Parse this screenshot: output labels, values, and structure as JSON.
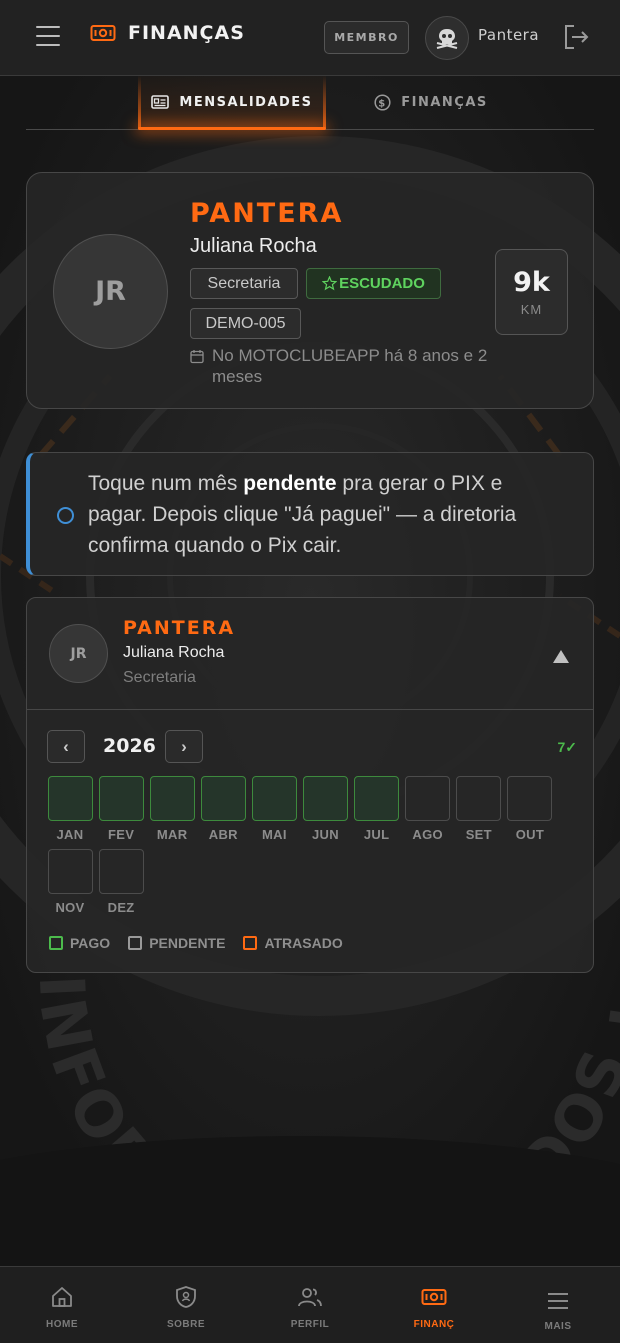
{
  "header": {
    "title": "FINANÇAS",
    "member_badge": "MEMBRO",
    "user_name": "Pantera"
  },
  "tabs": [
    {
      "label": "MENSALIDADES",
      "active": true
    },
    {
      "label": "FINANÇAS",
      "active": false
    }
  ],
  "profile": {
    "initials": "JR",
    "nickname": "PANTERA",
    "name": "Juliana Rocha",
    "role": "Secretaria",
    "status": "ESCUDADO",
    "code": "DEMO-005",
    "since": "No MOTOCLUBEAPP há 8 anos e 2 meses",
    "km_value": "9k",
    "km_label": "KM"
  },
  "info": {
    "text_before": "Toque num mês ",
    "text_bold": "pendente",
    "text_after": " pra gerar o PIX e pagar. Depois clique \"Já paguei\" — a diretoria confirma quando o Pix cair."
  },
  "member_card": {
    "initials": "JR",
    "nickname": "PANTERA",
    "name": "Juliana Rocha",
    "role": "Secretaria",
    "year": "2026",
    "prev_label": "‹",
    "next_label": "›",
    "paid_count": "7✓",
    "months": [
      {
        "label": "JAN",
        "status": "pago"
      },
      {
        "label": "FEV",
        "status": "pago"
      },
      {
        "label": "MAR",
        "status": "pago"
      },
      {
        "label": "ABR",
        "status": "pago"
      },
      {
        "label": "MAI",
        "status": "pago"
      },
      {
        "label": "JUN",
        "status": "pago"
      },
      {
        "label": "JUL",
        "status": "pago"
      },
      {
        "label": "AGO",
        "status": "pendente"
      },
      {
        "label": "SET",
        "status": "pendente"
      },
      {
        "label": "OUT",
        "status": "pendente"
      },
      {
        "label": "NOV",
        "status": "pendente"
      },
      {
        "label": "DEZ",
        "status": "pendente"
      }
    ],
    "legend": {
      "pago": "PAGO",
      "pendente": "PENDENTE",
      "atrasado": "ATRASADO"
    }
  },
  "background_text": "INFORMAÇÃO · DADOS · CONF",
  "bottom_nav": [
    {
      "label": "HOME",
      "icon": "home-icon"
    },
    {
      "label": "SOBRE",
      "icon": "shield-icon"
    },
    {
      "label": "PERFIL",
      "icon": "users-icon"
    },
    {
      "label": "FINANÇ",
      "icon": "money-icon",
      "active": true
    },
    {
      "label": "MAIS",
      "icon": "menu-icon"
    }
  ],
  "colors": {
    "accent": "#ff6a13",
    "paid": "#4cbb4c",
    "info": "#3f8fd6"
  }
}
